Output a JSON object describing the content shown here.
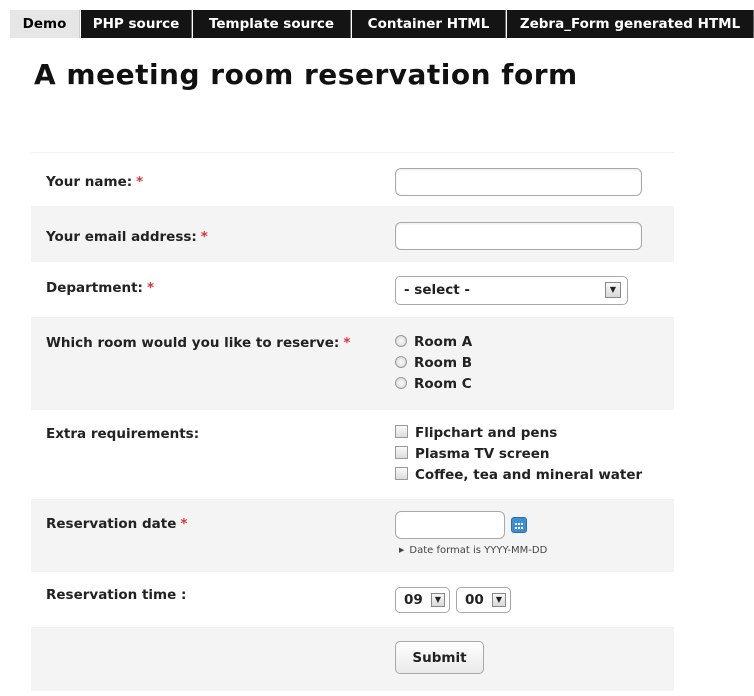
{
  "tabs": [
    {
      "label": "Demo",
      "active": true
    },
    {
      "label": "PHP source",
      "active": false
    },
    {
      "label": "Template source",
      "active": false
    },
    {
      "label": "Container HTML",
      "active": false
    },
    {
      "label": "Zebra_Form generated HTML",
      "active": false
    }
  ],
  "page_title": "A meeting room reservation form",
  "required_marker": "*",
  "form": {
    "name": {
      "label": "Your name:",
      "value": ""
    },
    "email": {
      "label": "Your email address:",
      "value": ""
    },
    "department": {
      "label": "Department:",
      "selected": "- select -"
    },
    "room": {
      "label": "Which room would you like to reserve:",
      "options": [
        "Room A",
        "Room B",
        "Room C"
      ]
    },
    "extras": {
      "label": "Extra requirements:",
      "options": [
        "Flipchart and pens",
        "Plasma TV screen",
        "Coffee, tea and mineral water"
      ]
    },
    "date": {
      "label": "Reservation date",
      "value": "",
      "hint": "Date format is YYYY-MM-DD"
    },
    "time": {
      "label": "Reservation time :",
      "hour": "09",
      "minute": "00"
    },
    "submit_label": "Submit"
  },
  "colors": {
    "tab_bg": "#141414",
    "tab_active_bg": "#e6e6e6",
    "required": "#dd3333",
    "row_shade": "#f4f4f4",
    "calendar_icon": "#3b8fd6"
  },
  "icons": {
    "calendar": "calendar-icon",
    "dropdown": "chevron-down-icon",
    "hint": "triangle-right-icon"
  }
}
